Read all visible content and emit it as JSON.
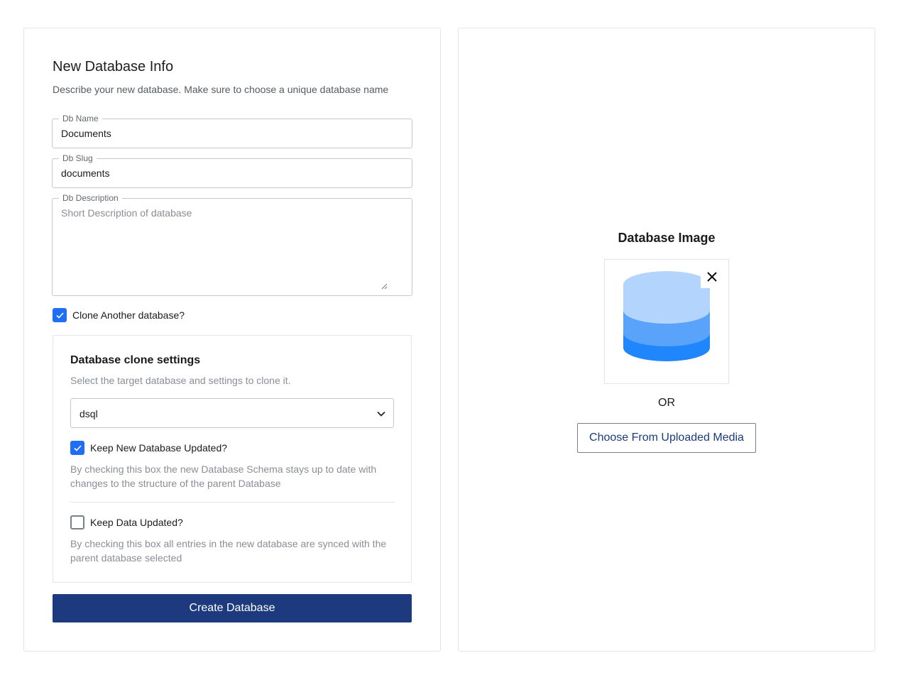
{
  "form": {
    "title": "New Database Info",
    "subtitle": "Describe your new database. Make sure to choose a unique database name",
    "db_name": {
      "label": "Db Name",
      "value": "Documents"
    },
    "db_slug": {
      "label": "Db Slug",
      "value": "documents"
    },
    "db_description": {
      "label": "Db Description",
      "value": "",
      "placeholder": "Short Description of database"
    },
    "clone_checkbox": {
      "label": "Clone Another database?",
      "checked": true
    },
    "submit_label": "Create Database"
  },
  "clone_settings": {
    "title": "Database clone settings",
    "subtitle": "Select the target database and settings to clone it.",
    "target_db": {
      "selected": "dsql"
    },
    "keep_schema": {
      "label": "Keep New Database Updated?",
      "checked": true,
      "help": "By checking this box the new Database Schema stays up to date with changes to the structure of the parent Database"
    },
    "keep_data": {
      "label": "Keep Data Updated?",
      "checked": false,
      "help": "By checking this box all entries in the new database are synced with the parent database selected"
    }
  },
  "image_panel": {
    "title": "Database Image",
    "image_icon": "database-stack-icon",
    "or_text": "OR",
    "choose_button_label": "Choose From Uploaded Media"
  },
  "colors": {
    "primary": "#1c3a7d",
    "checkbox": "#1f6ef5",
    "db_top": "#b3d4fd",
    "db_middle": "#5aa3fb",
    "db_bottom": "#1f86fb"
  }
}
